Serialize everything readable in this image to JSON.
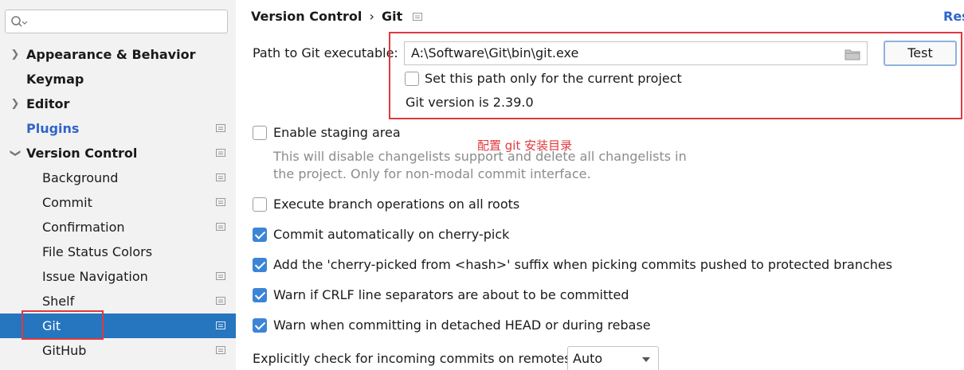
{
  "sidebar": {
    "search_placeholder": "",
    "items": [
      {
        "label": "Appearance & Behavior",
        "expander": "collapsed"
      },
      {
        "label": "Keymap"
      },
      {
        "label": "Editor",
        "expander": "collapsed"
      },
      {
        "label": "Plugins"
      },
      {
        "label": "Version Control",
        "expander": "expanded"
      },
      {
        "label": "Background"
      },
      {
        "label": "Commit"
      },
      {
        "label": "Confirmation"
      },
      {
        "label": "File Status Colors"
      },
      {
        "label": "Issue Navigation"
      },
      {
        "label": "Shelf"
      },
      {
        "label": "Git",
        "selected": true
      },
      {
        "label": "GitHub"
      }
    ]
  },
  "header": {
    "breadcrumb_parent": "Version Control",
    "separator": "›",
    "breadcrumb_current": "Git",
    "reset_label": "Res"
  },
  "git": {
    "path_label": "Path to Git executable:",
    "path_value": "A:\\Software\\Git\\bin\\git.exe",
    "test_label": "Test",
    "current_project_label": "Set this path only for the current project",
    "version_text": "Git version is 2.39.0"
  },
  "annotation": {
    "note": "配置 git 安装目录",
    "color": "#e0393e"
  },
  "options": {
    "staging_label": "Enable staging area",
    "staging_desc_1": "This will disable changelists support and delete all changelists in",
    "staging_desc_2": "the project. Only for non-modal commit interface.",
    "branch_ops_label": "Execute branch operations on all roots",
    "cherry_commit_label": "Commit automatically on cherry-pick",
    "cherry_suffix_label": "Add the 'cherry-picked from <hash>' suffix when picking commits pushed to protected branches",
    "crlf_label": "Warn if CRLF line separators are about to be committed",
    "detached_label": "Warn when committing in detached HEAD or during rebase",
    "incoming_label": "Explicitly check for incoming commits on remotes:",
    "incoming_value": "Auto"
  },
  "colors": {
    "accent": "#2675bf",
    "link": "#2f65ca",
    "sidebar_bg": "#f2f2f2"
  }
}
